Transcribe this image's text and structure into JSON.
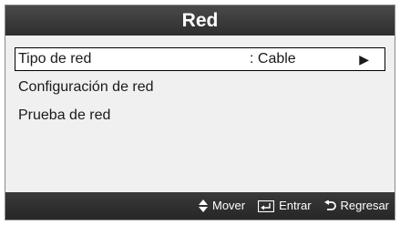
{
  "dialog": {
    "title": "Red"
  },
  "menu": {
    "items": [
      {
        "label": "Tipo de red",
        "value": ": Cable",
        "selected": true
      },
      {
        "label": "Configuración de red"
      },
      {
        "label": "Prueba de red"
      }
    ],
    "arrow_icon": "play-triangle-icon"
  },
  "footer": {
    "move": {
      "icon": "up-down-arrows-icon",
      "label": "Mover"
    },
    "enter": {
      "icon": "enter-key-icon",
      "label": "Entrar"
    },
    "return": {
      "icon": "return-arrow-icon",
      "label": "Regresar"
    }
  },
  "colors": {
    "title_bar": "#3a3a3a",
    "panel": "#f0f0f0",
    "selected_bg": "#ffffff",
    "text": "#1a1a1a"
  }
}
